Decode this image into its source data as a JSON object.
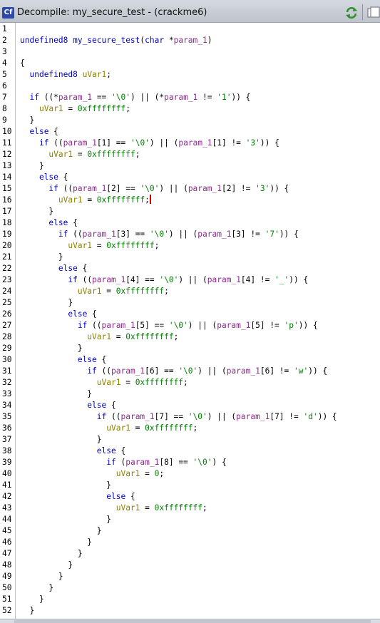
{
  "window": {
    "title": "Decompile: my_secure_test -  (crackme6)",
    "icon_label": "Cf",
    "icons": {
      "title": "decompiler-icon",
      "refresh": "refresh-icon",
      "snapshot": "snapshot-icon"
    }
  },
  "colors": {
    "keyword": "#0000c8",
    "parameter": "#8c2a8c",
    "variable": "#8b8000",
    "constant": "#008000",
    "cursor": "#d00000"
  },
  "lines": [
    {
      "n": "1",
      "tokens": []
    },
    {
      "n": "2",
      "tokens": [
        {
          "t": "undefined8",
          "c": "ty"
        },
        {
          "t": " ",
          "c": "plain"
        },
        {
          "t": "my_secure_test",
          "c": "fn"
        },
        {
          "t": "(",
          "c": "plain"
        },
        {
          "t": "char",
          "c": "ty"
        },
        {
          "t": " *",
          "c": "plain"
        },
        {
          "t": "param_1",
          "c": "prm"
        },
        {
          "t": ")",
          "c": "plain"
        }
      ]
    },
    {
      "n": "3",
      "tokens": []
    },
    {
      "n": "4",
      "tokens": [
        {
          "t": "{",
          "c": "plain"
        }
      ]
    },
    {
      "n": "5",
      "tokens": [
        {
          "t": "  ",
          "c": "plain"
        },
        {
          "t": "undefined8",
          "c": "ty"
        },
        {
          "t": " ",
          "c": "plain"
        },
        {
          "t": "uVar1",
          "c": "var"
        },
        {
          "t": ";",
          "c": "plain"
        }
      ]
    },
    {
      "n": "6",
      "tokens": []
    },
    {
      "n": "7",
      "tokens": [
        {
          "t": "  ",
          "c": "plain"
        },
        {
          "t": "if",
          "c": "kw"
        },
        {
          "t": " ((*",
          "c": "plain"
        },
        {
          "t": "param_1",
          "c": "prm"
        },
        {
          "t": " == ",
          "c": "plain"
        },
        {
          "t": "'\\0'",
          "c": "str"
        },
        {
          "t": ") || (*",
          "c": "plain"
        },
        {
          "t": "param_1",
          "c": "prm"
        },
        {
          "t": " != ",
          "c": "plain"
        },
        {
          "t": "'1'",
          "c": "str"
        },
        {
          "t": ")) {",
          "c": "plain"
        }
      ]
    },
    {
      "n": "8",
      "tokens": [
        {
          "t": "    ",
          "c": "plain"
        },
        {
          "t": "uVar1",
          "c": "var"
        },
        {
          "t": " = ",
          "c": "plain"
        },
        {
          "t": "0xffffffff",
          "c": "num"
        },
        {
          "t": ";",
          "c": "plain"
        }
      ]
    },
    {
      "n": "9",
      "tokens": [
        {
          "t": "  }",
          "c": "plain"
        }
      ]
    },
    {
      "n": "10",
      "tokens": [
        {
          "t": "  ",
          "c": "plain"
        },
        {
          "t": "else",
          "c": "kw"
        },
        {
          "t": " {",
          "c": "plain"
        }
      ]
    },
    {
      "n": "11",
      "tokens": [
        {
          "t": "    ",
          "c": "plain"
        },
        {
          "t": "if",
          "c": "kw"
        },
        {
          "t": " ((",
          "c": "plain"
        },
        {
          "t": "param_1",
          "c": "prm"
        },
        {
          "t": "[1] == ",
          "c": "plain"
        },
        {
          "t": "'\\0'",
          "c": "str"
        },
        {
          "t": ") || (",
          "c": "plain"
        },
        {
          "t": "param_1",
          "c": "prm"
        },
        {
          "t": "[1] != ",
          "c": "plain"
        },
        {
          "t": "'3'",
          "c": "str"
        },
        {
          "t": ")) {",
          "c": "plain"
        }
      ]
    },
    {
      "n": "12",
      "tokens": [
        {
          "t": "      ",
          "c": "plain"
        },
        {
          "t": "uVar1",
          "c": "var"
        },
        {
          "t": " = ",
          "c": "plain"
        },
        {
          "t": "0xffffffff",
          "c": "num"
        },
        {
          "t": ";",
          "c": "plain"
        }
      ]
    },
    {
      "n": "13",
      "tokens": [
        {
          "t": "    }",
          "c": "plain"
        }
      ]
    },
    {
      "n": "14",
      "tokens": [
        {
          "t": "    ",
          "c": "plain"
        },
        {
          "t": "else",
          "c": "kw"
        },
        {
          "t": " {",
          "c": "plain"
        }
      ]
    },
    {
      "n": "15",
      "tokens": [
        {
          "t": "      ",
          "c": "plain"
        },
        {
          "t": "if",
          "c": "kw"
        },
        {
          "t": " ((",
          "c": "plain"
        },
        {
          "t": "param_1",
          "c": "prm"
        },
        {
          "t": "[2] == ",
          "c": "plain"
        },
        {
          "t": "'\\0'",
          "c": "str"
        },
        {
          "t": ") || (",
          "c": "plain"
        },
        {
          "t": "param_1",
          "c": "prm"
        },
        {
          "t": "[2] != ",
          "c": "plain"
        },
        {
          "t": "'3'",
          "c": "str"
        },
        {
          "t": ")) {",
          "c": "plain"
        }
      ]
    },
    {
      "n": "16",
      "cursor": true,
      "tokens": [
        {
          "t": "        ",
          "c": "plain"
        },
        {
          "t": "uVar1",
          "c": "var"
        },
        {
          "t": " = ",
          "c": "plain"
        },
        {
          "t": "0xffffffff",
          "c": "num"
        },
        {
          "t": ";",
          "c": "plain"
        }
      ]
    },
    {
      "n": "17",
      "tokens": [
        {
          "t": "      }",
          "c": "plain"
        }
      ]
    },
    {
      "n": "18",
      "tokens": [
        {
          "t": "      ",
          "c": "plain"
        },
        {
          "t": "else",
          "c": "kw"
        },
        {
          "t": " {",
          "c": "plain"
        }
      ]
    },
    {
      "n": "19",
      "tokens": [
        {
          "t": "        ",
          "c": "plain"
        },
        {
          "t": "if",
          "c": "kw"
        },
        {
          "t": " ((",
          "c": "plain"
        },
        {
          "t": "param_1",
          "c": "prm"
        },
        {
          "t": "[3] == ",
          "c": "plain"
        },
        {
          "t": "'\\0'",
          "c": "str"
        },
        {
          "t": ") || (",
          "c": "plain"
        },
        {
          "t": "param_1",
          "c": "prm"
        },
        {
          "t": "[3] != ",
          "c": "plain"
        },
        {
          "t": "'7'",
          "c": "str"
        },
        {
          "t": ")) {",
          "c": "plain"
        }
      ]
    },
    {
      "n": "20",
      "tokens": [
        {
          "t": "          ",
          "c": "plain"
        },
        {
          "t": "uVar1",
          "c": "var"
        },
        {
          "t": " = ",
          "c": "plain"
        },
        {
          "t": "0xffffffff",
          "c": "num"
        },
        {
          "t": ";",
          "c": "plain"
        }
      ]
    },
    {
      "n": "21",
      "tokens": [
        {
          "t": "        }",
          "c": "plain"
        }
      ]
    },
    {
      "n": "22",
      "tokens": [
        {
          "t": "        ",
          "c": "plain"
        },
        {
          "t": "else",
          "c": "kw"
        },
        {
          "t": " {",
          "c": "plain"
        }
      ]
    },
    {
      "n": "23",
      "tokens": [
        {
          "t": "          ",
          "c": "plain"
        },
        {
          "t": "if",
          "c": "kw"
        },
        {
          "t": " ((",
          "c": "plain"
        },
        {
          "t": "param_1",
          "c": "prm"
        },
        {
          "t": "[4] == ",
          "c": "plain"
        },
        {
          "t": "'\\0'",
          "c": "str"
        },
        {
          "t": ") || (",
          "c": "plain"
        },
        {
          "t": "param_1",
          "c": "prm"
        },
        {
          "t": "[4] != ",
          "c": "plain"
        },
        {
          "t": "'_'",
          "c": "str"
        },
        {
          "t": ")) {",
          "c": "plain"
        }
      ]
    },
    {
      "n": "24",
      "tokens": [
        {
          "t": "            ",
          "c": "plain"
        },
        {
          "t": "uVar1",
          "c": "var"
        },
        {
          "t": " = ",
          "c": "plain"
        },
        {
          "t": "0xffffffff",
          "c": "num"
        },
        {
          "t": ";",
          "c": "plain"
        }
      ]
    },
    {
      "n": "25",
      "tokens": [
        {
          "t": "          }",
          "c": "plain"
        }
      ]
    },
    {
      "n": "26",
      "tokens": [
        {
          "t": "          ",
          "c": "plain"
        },
        {
          "t": "else",
          "c": "kw"
        },
        {
          "t": " {",
          "c": "plain"
        }
      ]
    },
    {
      "n": "27",
      "tokens": [
        {
          "t": "            ",
          "c": "plain"
        },
        {
          "t": "if",
          "c": "kw"
        },
        {
          "t": " ((",
          "c": "plain"
        },
        {
          "t": "param_1",
          "c": "prm"
        },
        {
          "t": "[5] == ",
          "c": "plain"
        },
        {
          "t": "'\\0'",
          "c": "str"
        },
        {
          "t": ") || (",
          "c": "plain"
        },
        {
          "t": "param_1",
          "c": "prm"
        },
        {
          "t": "[5] != ",
          "c": "plain"
        },
        {
          "t": "'p'",
          "c": "str"
        },
        {
          "t": ")) {",
          "c": "plain"
        }
      ]
    },
    {
      "n": "28",
      "tokens": [
        {
          "t": "              ",
          "c": "plain"
        },
        {
          "t": "uVar1",
          "c": "var"
        },
        {
          "t": " = ",
          "c": "plain"
        },
        {
          "t": "0xffffffff",
          "c": "num"
        },
        {
          "t": ";",
          "c": "plain"
        }
      ]
    },
    {
      "n": "29",
      "tokens": [
        {
          "t": "            }",
          "c": "plain"
        }
      ]
    },
    {
      "n": "30",
      "tokens": [
        {
          "t": "            ",
          "c": "plain"
        },
        {
          "t": "else",
          "c": "kw"
        },
        {
          "t": " {",
          "c": "plain"
        }
      ]
    },
    {
      "n": "31",
      "tokens": [
        {
          "t": "              ",
          "c": "plain"
        },
        {
          "t": "if",
          "c": "kw"
        },
        {
          "t": " ((",
          "c": "plain"
        },
        {
          "t": "param_1",
          "c": "prm"
        },
        {
          "t": "[6] == ",
          "c": "plain"
        },
        {
          "t": "'\\0'",
          "c": "str"
        },
        {
          "t": ") || (",
          "c": "plain"
        },
        {
          "t": "param_1",
          "c": "prm"
        },
        {
          "t": "[6] != ",
          "c": "plain"
        },
        {
          "t": "'w'",
          "c": "str"
        },
        {
          "t": ")) {",
          "c": "plain"
        }
      ]
    },
    {
      "n": "32",
      "tokens": [
        {
          "t": "                ",
          "c": "plain"
        },
        {
          "t": "uVar1",
          "c": "var"
        },
        {
          "t": " = ",
          "c": "plain"
        },
        {
          "t": "0xffffffff",
          "c": "num"
        },
        {
          "t": ";",
          "c": "plain"
        }
      ]
    },
    {
      "n": "33",
      "tokens": [
        {
          "t": "              }",
          "c": "plain"
        }
      ]
    },
    {
      "n": "34",
      "tokens": [
        {
          "t": "              ",
          "c": "plain"
        },
        {
          "t": "else",
          "c": "kw"
        },
        {
          "t": " {",
          "c": "plain"
        }
      ]
    },
    {
      "n": "35",
      "tokens": [
        {
          "t": "                ",
          "c": "plain"
        },
        {
          "t": "if",
          "c": "kw"
        },
        {
          "t": " ((",
          "c": "plain"
        },
        {
          "t": "param_1",
          "c": "prm"
        },
        {
          "t": "[7] == ",
          "c": "plain"
        },
        {
          "t": "'\\0'",
          "c": "str"
        },
        {
          "t": ") || (",
          "c": "plain"
        },
        {
          "t": "param_1",
          "c": "prm"
        },
        {
          "t": "[7] != ",
          "c": "plain"
        },
        {
          "t": "'d'",
          "c": "str"
        },
        {
          "t": ")) {",
          "c": "plain"
        }
      ]
    },
    {
      "n": "36",
      "tokens": [
        {
          "t": "                  ",
          "c": "plain"
        },
        {
          "t": "uVar1",
          "c": "var"
        },
        {
          "t": " = ",
          "c": "plain"
        },
        {
          "t": "0xffffffff",
          "c": "num"
        },
        {
          "t": ";",
          "c": "plain"
        }
      ]
    },
    {
      "n": "37",
      "tokens": [
        {
          "t": "                }",
          "c": "plain"
        }
      ]
    },
    {
      "n": "38",
      "tokens": [
        {
          "t": "                ",
          "c": "plain"
        },
        {
          "t": "else",
          "c": "kw"
        },
        {
          "t": " {",
          "c": "plain"
        }
      ]
    },
    {
      "n": "39",
      "tokens": [
        {
          "t": "                  ",
          "c": "plain"
        },
        {
          "t": "if",
          "c": "kw"
        },
        {
          "t": " (",
          "c": "plain"
        },
        {
          "t": "param_1",
          "c": "prm"
        },
        {
          "t": "[8] == ",
          "c": "plain"
        },
        {
          "t": "'\\0'",
          "c": "str"
        },
        {
          "t": ") {",
          "c": "plain"
        }
      ]
    },
    {
      "n": "40",
      "tokens": [
        {
          "t": "                    ",
          "c": "plain"
        },
        {
          "t": "uVar1",
          "c": "var"
        },
        {
          "t": " = ",
          "c": "plain"
        },
        {
          "t": "0",
          "c": "num"
        },
        {
          "t": ";",
          "c": "plain"
        }
      ]
    },
    {
      "n": "41",
      "tokens": [
        {
          "t": "                  }",
          "c": "plain"
        }
      ]
    },
    {
      "n": "42",
      "tokens": [
        {
          "t": "                  ",
          "c": "plain"
        },
        {
          "t": "else",
          "c": "kw"
        },
        {
          "t": " {",
          "c": "plain"
        }
      ]
    },
    {
      "n": "43",
      "tokens": [
        {
          "t": "                    ",
          "c": "plain"
        },
        {
          "t": "uVar1",
          "c": "var"
        },
        {
          "t": " = ",
          "c": "plain"
        },
        {
          "t": "0xffffffff",
          "c": "num"
        },
        {
          "t": ";",
          "c": "plain"
        }
      ]
    },
    {
      "n": "44",
      "tokens": [
        {
          "t": "                  }",
          "c": "plain"
        }
      ]
    },
    {
      "n": "45",
      "tokens": [
        {
          "t": "                }",
          "c": "plain"
        }
      ]
    },
    {
      "n": "46",
      "tokens": [
        {
          "t": "              }",
          "c": "plain"
        }
      ]
    },
    {
      "n": "47",
      "tokens": [
        {
          "t": "            }",
          "c": "plain"
        }
      ]
    },
    {
      "n": "48",
      "tokens": [
        {
          "t": "          }",
          "c": "plain"
        }
      ]
    },
    {
      "n": "49",
      "tokens": [
        {
          "t": "        }",
          "c": "plain"
        }
      ]
    },
    {
      "n": "50",
      "tokens": [
        {
          "t": "      }",
          "c": "plain"
        }
      ]
    },
    {
      "n": "51",
      "tokens": [
        {
          "t": "    }",
          "c": "plain"
        }
      ]
    },
    {
      "n": "52",
      "tokens": [
        {
          "t": "  }",
          "c": "plain"
        }
      ]
    }
  ]
}
